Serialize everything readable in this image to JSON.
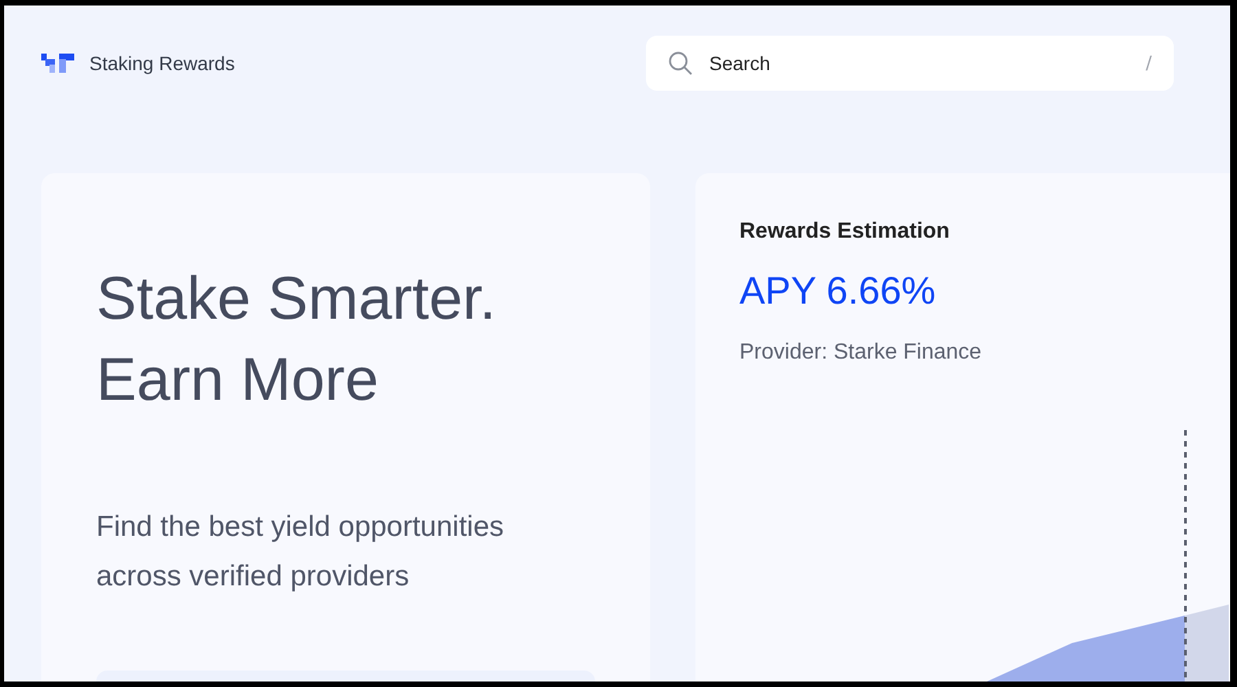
{
  "header": {
    "brand": "Staking Rewards",
    "search": {
      "placeholder": "Search",
      "shortcut": "/"
    }
  },
  "hero": {
    "headline": "Stake Smarter. Earn More",
    "subtitle": "Find the best yield opportunities across verified providers"
  },
  "rewards": {
    "title": "Rewards Estimation",
    "apy": "APY 6.66%",
    "provider": "Provider: Starke Finance"
  }
}
